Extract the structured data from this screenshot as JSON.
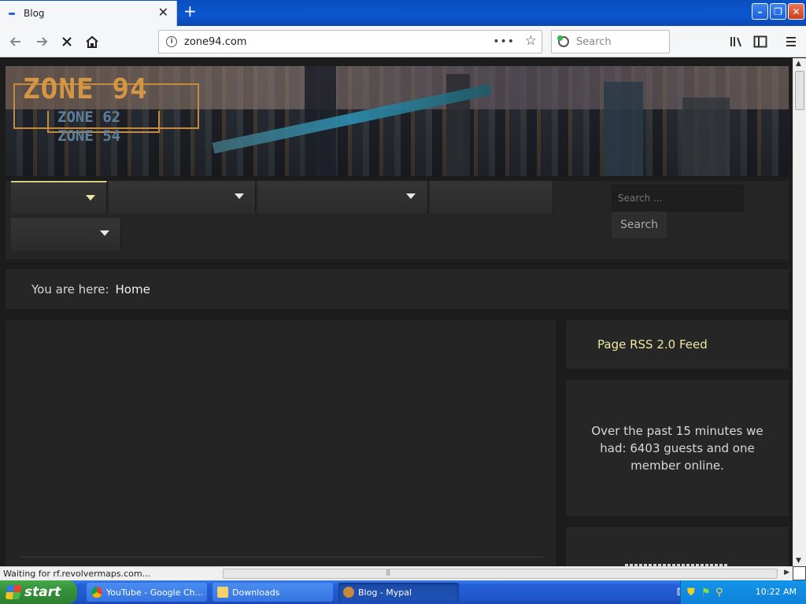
{
  "browser": {
    "tab": {
      "title": "Blog",
      "close_glyph": "✕"
    },
    "new_tab_glyph": "+",
    "url": "zone94.com",
    "search_placeholder": "Search",
    "url_more_glyph": "•••",
    "window_buttons": {
      "minimize": "–",
      "restore": "❐",
      "close": "✕"
    }
  },
  "site": {
    "logo": {
      "main": "ZONE 94",
      "sub1": "ZONE 62",
      "sub2": "ZONE 54"
    },
    "search": {
      "placeholder": "Search ...",
      "button": "Search"
    },
    "breadcrumb": {
      "prefix": "You are here:",
      "current": "Home"
    },
    "sidebar": {
      "rss_link": "Page RSS 2.0 Feed",
      "stats": "Over the past 15 minutes we had: 6403 guests and one member online."
    }
  },
  "status": {
    "text": "Waiting for rf.revolvermaps.com..."
  },
  "taskbar": {
    "start": "start",
    "tasks": [
      {
        "label": "YouTube - Google Ch..."
      },
      {
        "label": "Downloads"
      },
      {
        "label": "Blog - Mypal"
      }
    ],
    "clock": "10:22 AM"
  },
  "colors": {
    "accent_yellow": "#eee9a0",
    "logo_orange": "#d49545",
    "logo_blue": "#5d7f9a"
  }
}
